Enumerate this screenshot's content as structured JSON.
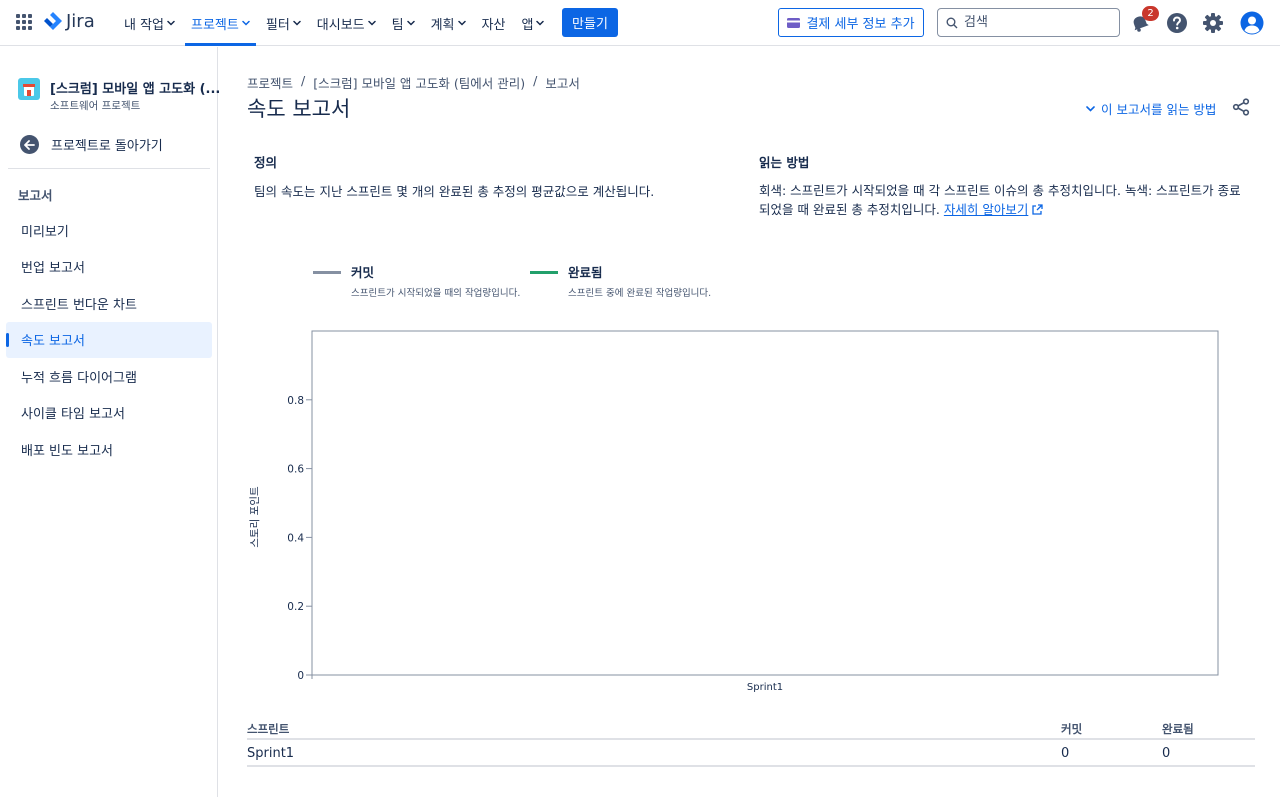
{
  "nav": {
    "logo": "Jira",
    "items": [
      {
        "label": "내 작업",
        "chevron": true,
        "active": false
      },
      {
        "label": "프로젝트",
        "chevron": true,
        "active": true
      },
      {
        "label": "필터",
        "chevron": true,
        "active": false
      },
      {
        "label": "대시보드",
        "chevron": true,
        "active": false
      },
      {
        "label": "팀",
        "chevron": true,
        "active": false
      },
      {
        "label": "계획",
        "chevron": true,
        "active": false
      },
      {
        "label": "자산",
        "chevron": false,
        "active": false
      },
      {
        "label": "앱",
        "chevron": true,
        "active": false
      }
    ],
    "create_label": "만들기",
    "billing_label": "결제 세부 정보 추가",
    "search_placeholder": "검색",
    "notification_count": "2",
    "accent": "#0c66e4"
  },
  "sidebar": {
    "project_title": "[스크럼] 모바일 앱 고도화 (...",
    "project_subtitle": "소프트웨어 프로젝트",
    "back_label": "프로젝트로 돌아가기",
    "section_title": "보고서",
    "items": [
      {
        "label": "미리보기",
        "active": false
      },
      {
        "label": "번업 보고서",
        "active": false
      },
      {
        "label": "스프린트 번다운 차트",
        "active": false
      },
      {
        "label": "속도 보고서",
        "active": true
      },
      {
        "label": "누적 흐름 다이어그램",
        "active": false
      },
      {
        "label": "사이클 타임 보고서",
        "active": false
      },
      {
        "label": "배포 빈도 보고서",
        "active": false
      }
    ]
  },
  "main": {
    "breadcrumb": [
      "프로젝트",
      "/",
      "[스크럼] 모바일 앱 고도화 (팀에서 관리)",
      "/",
      "보고서"
    ],
    "title": "속도 보고서",
    "howto_label": "이 보고서를 읽는 방법",
    "definition": {
      "heading": "정의",
      "text": "팀의 속도는 지난 스프린트 몇 개의 완료된 총 추정의 평균값으로 계산됩니다."
    },
    "reading": {
      "heading": "읽는 방법",
      "text": "회색: 스프린트가 시작되었을 때 각 스프린트 이슈의 총 추정치입니다. 녹색: 스프린트가 종료되었을 때 완료된 총 추정치입니다.",
      "link": "자세히 알아보기"
    },
    "legend": [
      {
        "name": "커밋",
        "desc": "스프린트가 시작되었을 때의 작업량입니다.",
        "color": "#8590a2"
      },
      {
        "name": "완료됨",
        "desc": "스프린트 중에 완료된 작업량입니다.",
        "color": "#22a06b"
      }
    ],
    "table": {
      "headers": [
        "스프린트",
        "커밋",
        "완료됨"
      ],
      "rows": [
        {
          "sprint": "Sprint1",
          "commit": "0",
          "done": "0"
        }
      ]
    }
  },
  "chart_data": {
    "type": "bar",
    "categories": [
      "Sprint1"
    ],
    "series": [
      {
        "name": "커밋",
        "values": [
          0
        ],
        "color": "#8590a2"
      },
      {
        "name": "완료됨",
        "values": [
          0
        ],
        "color": "#22a06b"
      }
    ],
    "ylabel": "스토리 포인트",
    "ylim": [
      0,
      1
    ],
    "yticks": [
      0,
      0.2,
      0.4,
      0.6,
      0.8
    ],
    "grid": false,
    "legend_position": "top-left"
  }
}
